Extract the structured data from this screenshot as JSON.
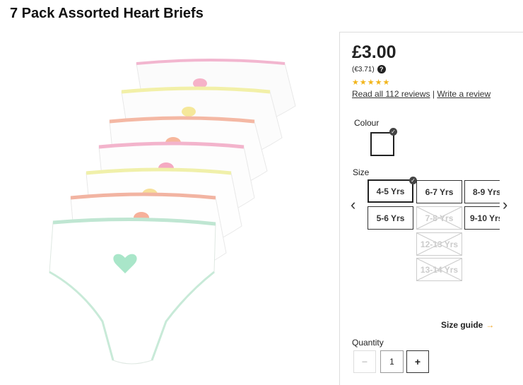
{
  "product": {
    "title": "7 Pack Assorted Heart Briefs",
    "price": "£3.00",
    "price_eur": "(€3.71)",
    "rating_stars": 5,
    "star_glyphs": "★★★★★",
    "read_reviews": "Read all 112 reviews",
    "separator": "|",
    "write_review": "Write a review"
  },
  "colour": {
    "label": "Colour",
    "selected_swatch": "#ffffff"
  },
  "size": {
    "label": "Size",
    "options": [
      {
        "label": "4-5 Yrs",
        "state": "selected"
      },
      {
        "label": "6-7 Yrs",
        "state": "available"
      },
      {
        "label": "8-9 Yrs",
        "state": "available"
      },
      {
        "label": "5-6 Yrs",
        "state": "available"
      },
      {
        "label": "7-8 Yrs",
        "state": "unavailable"
      },
      {
        "label": "9-10 Yrs",
        "state": "available"
      },
      {
        "label": "12-13 Yrs",
        "state": "unavailable"
      },
      {
        "label": "13-14 Yrs",
        "state": "unavailable"
      }
    ],
    "guide": "Size guide",
    "guide_arrow": "→"
  },
  "quantity": {
    "label": "Quantity",
    "value": "1",
    "minus": "−",
    "plus": "+"
  },
  "icons": {
    "help": "?",
    "check": "✓",
    "prev": "‹",
    "next": "›"
  },
  "colors": {
    "star": "#f2b51b",
    "accent_arrow": "#f2a31b",
    "disabled": "#cccccc"
  }
}
